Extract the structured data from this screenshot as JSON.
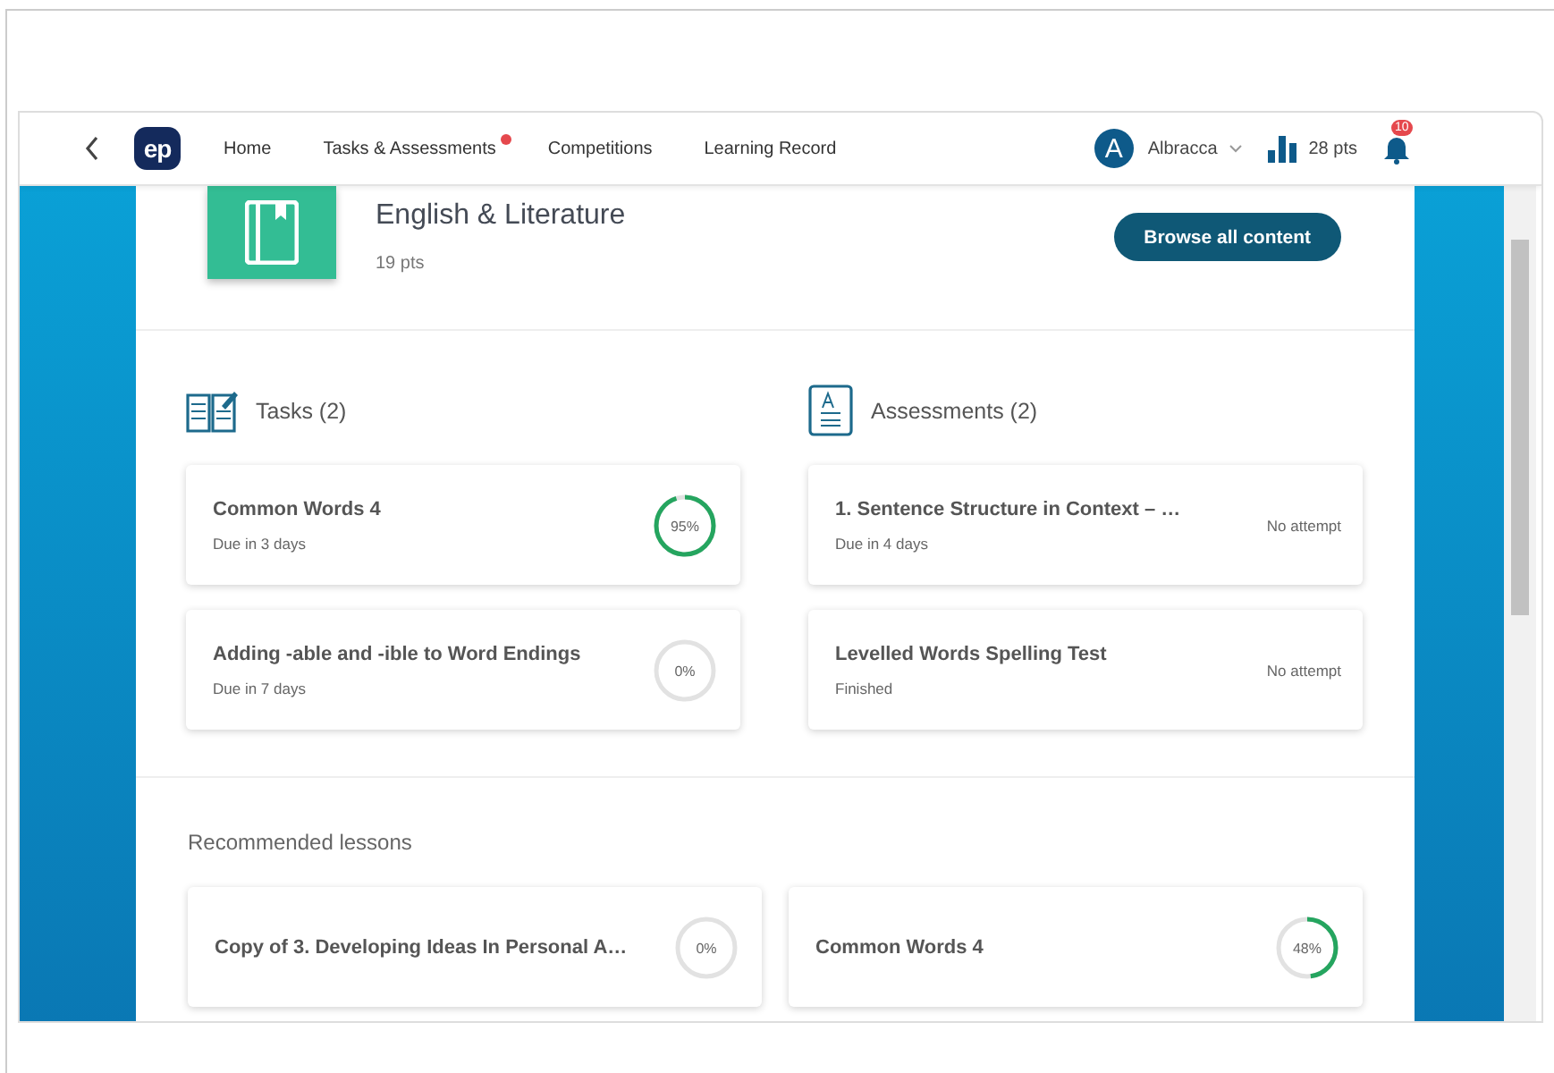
{
  "nav": {
    "logo": "ep",
    "items": [
      {
        "label": "Home",
        "has_alert": false
      },
      {
        "label": "Tasks & Assessments",
        "has_alert": true
      },
      {
        "label": "Competitions",
        "has_alert": false
      },
      {
        "label": "Learning Record",
        "has_alert": false
      }
    ],
    "user": {
      "initial": "A",
      "name": "Albracca"
    },
    "points": "28 pts",
    "notifications": "10"
  },
  "subject": {
    "title": "English & Literature",
    "points": "19 pts",
    "button": "Browse all content"
  },
  "tasks": {
    "heading": "Tasks (2)",
    "items": [
      {
        "title": "Common Words 4",
        "due": "Due in 3 days",
        "progress": "95%"
      },
      {
        "title": "Adding -able and -ible to Word Endings",
        "due": "Due in 7 days",
        "progress": "0%"
      }
    ]
  },
  "assessments": {
    "heading": "Assessments (2)",
    "items": [
      {
        "title": "1. Sentence Structure in Context – …",
        "due": "Due in 4 days",
        "status": "No attempt"
      },
      {
        "title": "Levelled Words Spelling Test",
        "due": "Finished",
        "status": "No attempt"
      }
    ]
  },
  "recommended": {
    "heading": "Recommended lessons",
    "items": [
      {
        "title": "Copy of 3. Developing Ideas In Personal A…",
        "progress": "0%"
      },
      {
        "title": "Common Words 4",
        "progress": "48%"
      }
    ]
  }
}
